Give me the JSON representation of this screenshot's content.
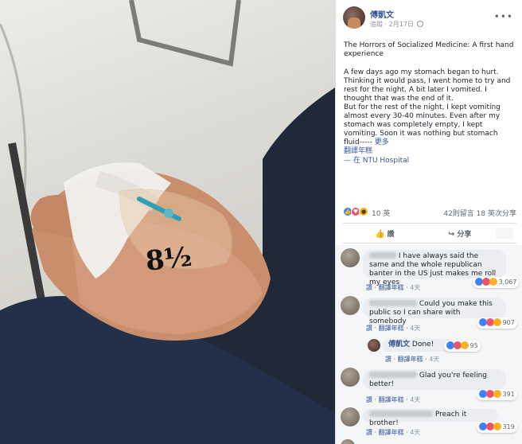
{
  "post": {
    "author": "傅凱文",
    "follow_label": "追蹤",
    "date": "2月17日",
    "title": "The Horrors of Socialized Medicine: A first hand experience",
    "body_paragraphs": [
      "A few days ago my stomach began to hurt. Thinking it would pass, I went home to try and rest for the night. A bit later I vomited. I thought that was the end of it.",
      "But for the rest of the night, I kept vomiting almost every 30-40 minutes. Even after my stomach was completely empty, I kept vomiting. Soon it was nothing but stomach fluid-----"
    ],
    "see_more": "更多",
    "translate": "翻譯年糕",
    "checkin": "— 在 NTU Hospital",
    "photo_writing": "8½"
  },
  "reactions": {
    "count": "10 英",
    "comments": "42則留言",
    "shares": "18 英次分享"
  },
  "actions": {
    "like": "讚",
    "share": "分享"
  },
  "comments": [
    {
      "text": "I have always said the same and the whole republican banter in the US just makes me roll my eyes",
      "like": "讚",
      "translate": "翻譯年糕",
      "time": "4天",
      "react_count": "3,067"
    },
    {
      "text": "Could you make this public so I can share with somebody",
      "like": "讚",
      "translate": "翻譯年糕",
      "time": "4天",
      "react_count": "907"
    },
    {
      "author": "傅凱文",
      "text": "Done!",
      "like": "讚",
      "translate": "翻譯年糕",
      "time": "4天",
      "react_count": "95"
    },
    {
      "text": "Glad you're feeling better!",
      "like": "讚",
      "translate": "翻譯年糕",
      "time": "4天",
      "react_count": "391"
    },
    {
      "text": "Preach it brother!",
      "like": "讚",
      "translate": "翻譯年糕",
      "time": "4天",
      "react_count": "319"
    }
  ],
  "colors": {
    "link": "#365899",
    "like": "#4080ff",
    "love": "#f25268",
    "haha": "#f7b125"
  },
  "icons": {
    "like": "thumbs-up-icon",
    "share": "share-arrow-icon",
    "privacy": "globe-icon",
    "more": "ellipsis-icon"
  }
}
